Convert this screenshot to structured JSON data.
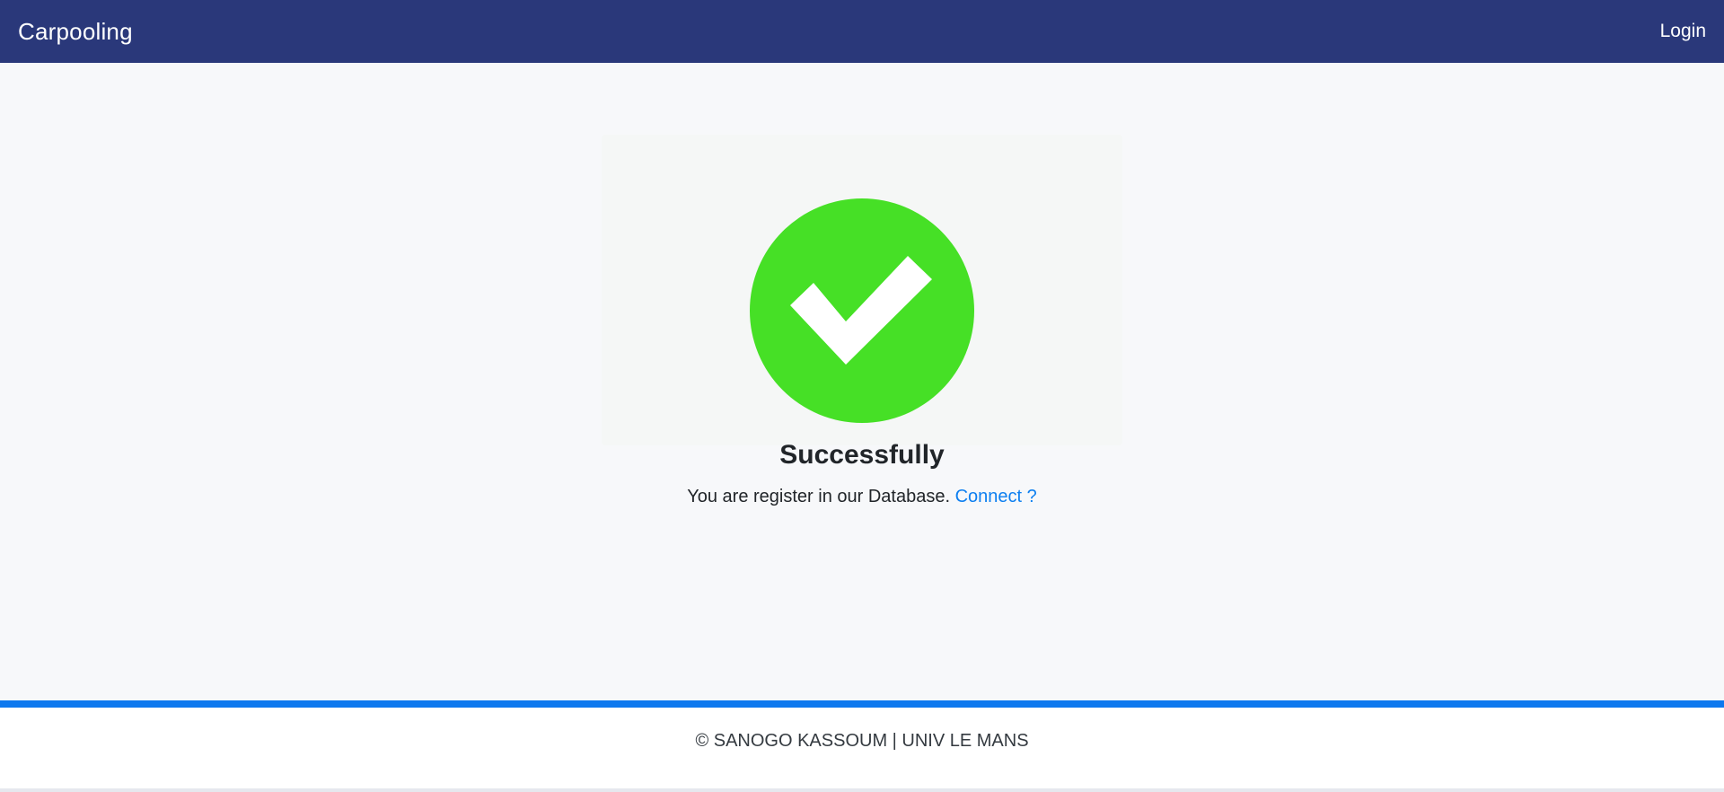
{
  "navbar": {
    "brand": "Carpooling",
    "login_label": "Login",
    "background_color": "#2a387a"
  },
  "success": {
    "icon": "check-circle-icon",
    "icon_color": "#46e026",
    "title": "Successfully",
    "message": "You are register in our Database.",
    "link_label": "Connect ?",
    "link_color": "#0d7ff0"
  },
  "footer": {
    "text": "© SANOGO KASSOUM | UNIV LE MANS",
    "accent_color": "#0d78ee"
  }
}
